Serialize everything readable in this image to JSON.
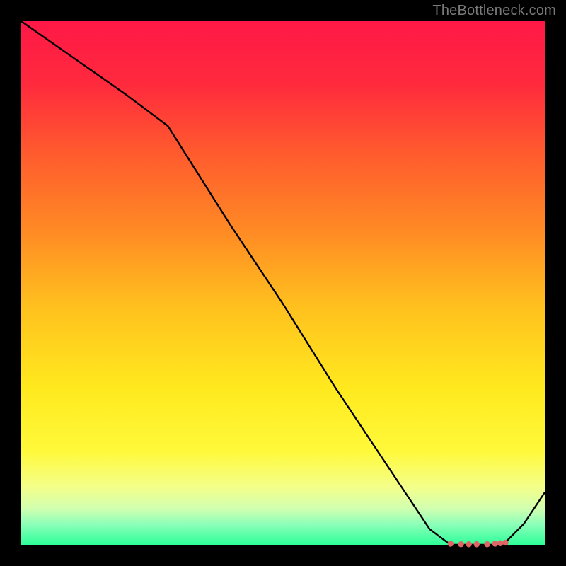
{
  "watermark": "TheBottleneck.com",
  "chart_data": {
    "type": "line",
    "title": "",
    "xlabel": "",
    "ylabel": "",
    "xlim": [
      0,
      100
    ],
    "ylim": [
      0,
      100
    ],
    "x": [
      0,
      10,
      20,
      28,
      40,
      50,
      60,
      70,
      78,
      82,
      86,
      90,
      92,
      96,
      100
    ],
    "values": [
      100,
      93,
      86,
      80,
      61,
      46,
      30,
      15,
      3,
      0,
      0,
      0,
      0,
      4,
      10
    ],
    "marker_points": {
      "x": [
        82,
        84,
        85.5,
        87,
        89,
        90.5,
        91.5,
        92.5
      ],
      "y": [
        0.2,
        0.1,
        0.1,
        0.1,
        0.1,
        0.2,
        0.3,
        0.4
      ]
    },
    "gradient_stops": [
      {
        "offset": 0.0,
        "color": "#ff1847"
      },
      {
        "offset": 0.12,
        "color": "#ff2a3d"
      },
      {
        "offset": 0.25,
        "color": "#ff5a2e"
      },
      {
        "offset": 0.4,
        "color": "#ff8a24"
      },
      {
        "offset": 0.55,
        "color": "#ffc21e"
      },
      {
        "offset": 0.7,
        "color": "#ffe91e"
      },
      {
        "offset": 0.82,
        "color": "#fff93a"
      },
      {
        "offset": 0.89,
        "color": "#f4ff8a"
      },
      {
        "offset": 0.93,
        "color": "#d2ffb0"
      },
      {
        "offset": 0.96,
        "color": "#8effb8"
      },
      {
        "offset": 1.0,
        "color": "#2dff9a"
      }
    ],
    "line_color": "#000000",
    "marker_color": "#e06666"
  }
}
